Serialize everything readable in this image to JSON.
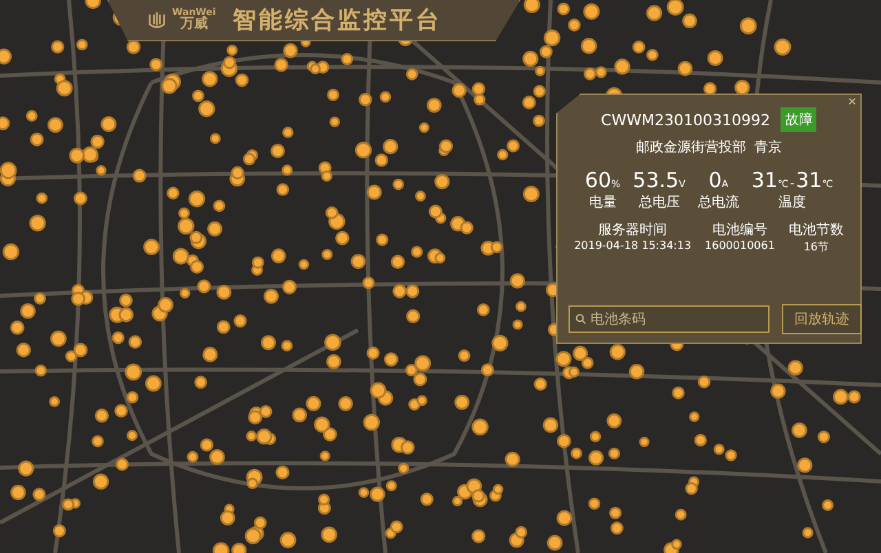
{
  "header": {
    "logo_latin": "WanWei",
    "logo_cn": "万威",
    "title": "智能综合监控平台"
  },
  "panel": {
    "close": "×",
    "device_id": "CWWM230100310992",
    "status": {
      "label": "故障",
      "kind": "fault"
    },
    "location": [
      "邮政金源街营投部",
      "青京"
    ],
    "metrics": [
      {
        "readings": [
          {
            "value": "60",
            "unit": "%"
          }
        ],
        "label": "电量"
      },
      {
        "readings": [
          {
            "value": "53.5",
            "unit": "V"
          }
        ],
        "label": "总电压"
      },
      {
        "readings": [
          {
            "value": "0",
            "unit": "A"
          }
        ],
        "label": "总电流"
      },
      {
        "readings": [
          {
            "value": "31",
            "unit": "℃"
          },
          {
            "value": "31",
            "unit": "℃"
          }
        ],
        "separator": "-",
        "label": "温度"
      }
    ],
    "info": [
      {
        "label": "服务器时间",
        "value": "2019-04-18 15:34:13"
      },
      {
        "label": "电池编号",
        "value": "1600010061"
      },
      {
        "label": "电池节数",
        "value": "16节"
      }
    ],
    "search": {
      "placeholder": "电池条码"
    },
    "button": "回放轨迹"
  }
}
